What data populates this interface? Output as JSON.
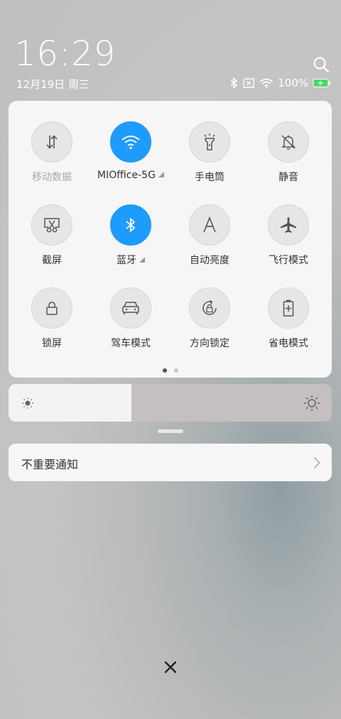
{
  "status_bar": {
    "time": "16:29",
    "date": "12月19日 周三",
    "battery": "100%"
  },
  "toggles": [
    {
      "label": "移动数据",
      "icon": "mobile-data-icon",
      "active": false,
      "dim": true,
      "triangle": false
    },
    {
      "label": "MIOffice-5G",
      "icon": "wifi-icon",
      "active": true,
      "dim": false,
      "triangle": true
    },
    {
      "label": "手电筒",
      "icon": "flashlight-icon",
      "active": false,
      "dim": false,
      "triangle": false
    },
    {
      "label": "静音",
      "icon": "mute-bell-icon",
      "active": false,
      "dim": false,
      "triangle": false
    },
    {
      "label": "截屏",
      "icon": "screenshot-icon",
      "active": false,
      "dim": false,
      "triangle": false
    },
    {
      "label": "蓝牙",
      "icon": "bluetooth-icon",
      "active": true,
      "dim": false,
      "triangle": true
    },
    {
      "label": "自动亮度",
      "icon": "auto-brightness-icon",
      "active": false,
      "dim": false,
      "triangle": false
    },
    {
      "label": "飞行模式",
      "icon": "airplane-icon",
      "active": false,
      "dim": false,
      "triangle": false
    },
    {
      "label": "锁屏",
      "icon": "lock-icon",
      "active": false,
      "dim": false,
      "triangle": false
    },
    {
      "label": "驾车模式",
      "icon": "car-icon",
      "active": false,
      "dim": false,
      "triangle": false
    },
    {
      "label": "方向锁定",
      "icon": "rotation-lock-icon",
      "active": false,
      "dim": false,
      "triangle": false
    },
    {
      "label": "省电模式",
      "icon": "battery-saver-icon",
      "active": false,
      "dim": false,
      "triangle": false
    }
  ],
  "pages": {
    "count": 2,
    "current": 0
  },
  "brightness": {
    "level": 0.38
  },
  "notification": {
    "label": "不重要通知"
  },
  "colors": {
    "accent": "#1e9bff",
    "battery": "#4cd964"
  }
}
